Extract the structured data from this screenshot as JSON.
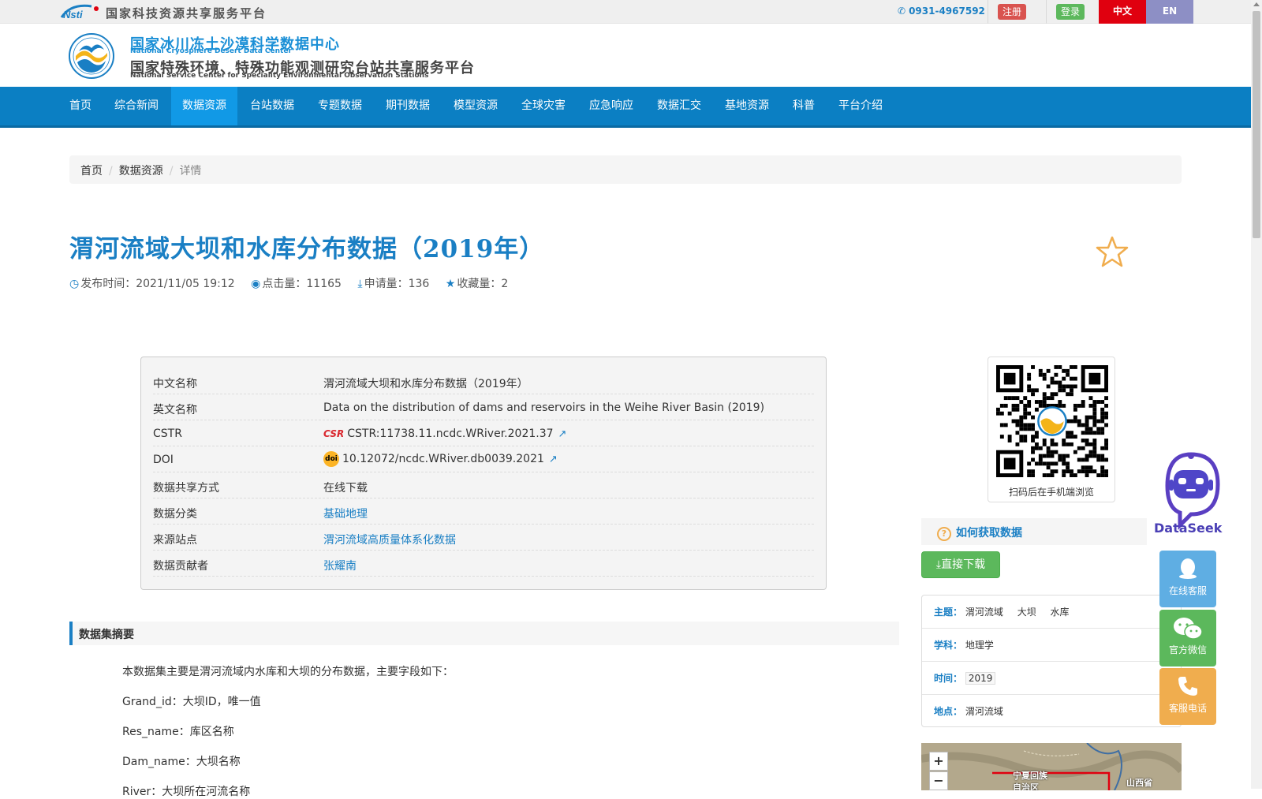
{
  "topbar": {
    "title": "国家科技资源共享服务平台",
    "phone": "0931-4967592",
    "register": "注册",
    "login": "登录",
    "lang_zh": "中文",
    "lang_en": "EN"
  },
  "header": {
    "title1": "国家冰川冻土沙漠科学数据中心",
    "sub1": "National Cryosphere Desert Data Center",
    "title2": "国家特殊环境、特殊功能观测研究台站共享服务平台",
    "sub2": "National Service Center for Speciality Environmental Observation Stations"
  },
  "nav": {
    "items": [
      "首页",
      "综合新闻",
      "数据资源",
      "台站数据",
      "专题数据",
      "期刊数据",
      "模型资源",
      "全球灾害",
      "应急响应",
      "数据汇交",
      "基地资源",
      "科普",
      "平台介绍"
    ],
    "active": "数据资源"
  },
  "breadcrumb": {
    "home": "首页",
    "section": "数据资源",
    "current": "详情"
  },
  "dataset": {
    "title": "渭河流域大坝和水库分布数据（2019年）",
    "meta": {
      "publish_label": "发布时间：",
      "publish_time": "2021/11/05 19:12",
      "clicks_label": "点击量：",
      "clicks": "11165",
      "applies_label": "申请量：",
      "applies": "136",
      "favorites_label": "收藏量：",
      "favorites": "2"
    }
  },
  "info": {
    "rows": [
      {
        "key": "中文名称",
        "value": "渭河流域大坝和水库分布数据（2019年）"
      },
      {
        "key": "英文名称",
        "value": "Data on the distribution of dams and reservoirs in the Weihe River Basin (2019)"
      },
      {
        "key": "CSTR",
        "value": "CSTR:11738.11.ncdc.WRiver.2021.37"
      },
      {
        "key": "DOI",
        "value": "10.12072/ncdc.WRiver.db0039.2021"
      },
      {
        "key": "数据共享方式",
        "value": "在线下载"
      },
      {
        "key": "数据分类",
        "value": "基础地理"
      },
      {
        "key": "来源站点",
        "value": "渭河流域高质量体系化数据"
      },
      {
        "key": "数据贡献者",
        "value": "张耀南"
      }
    ],
    "cstr_badge": "CSR",
    "doi_badge": "doi"
  },
  "abstract": {
    "heading": "数据集摘要",
    "paragraphs": [
      "本数据集主要是渭河流域内水库和大坝的分布数据，主要字段如下：",
      "Grand_id：大坝ID，唯一值",
      "Res_name：库区名称",
      "Dam_name：大坝名称",
      "River：大坝所在河流名称"
    ]
  },
  "sidebar": {
    "qr_caption": "扫码后在手机端浏览",
    "how_heading": "如何获取数据",
    "download_button": "直接下载",
    "tags": {
      "theme_label": "主题：",
      "themes": [
        "渭河流域",
        "大坝",
        "水库"
      ],
      "subject_label": "学科：",
      "subject": "地理学",
      "time_label": "时间：",
      "time": "2019",
      "place_label": "地点：",
      "place": "渭河流域"
    },
    "map": {
      "zoom_in": "+",
      "zoom_out": "−",
      "label1": "宁夏回族",
      "label2": "自治区",
      "label3": "山西省"
    }
  },
  "widgets": {
    "dataseek": "DataSeek",
    "online_service": "在线客服",
    "wechat": "官方微信",
    "phone_service": "客服电话"
  },
  "colors": {
    "primary": "#0b7fc3",
    "link": "#1a7fc4",
    "green": "#5cb85c",
    "orange": "#f0ad4e",
    "red": "#e0000f"
  }
}
